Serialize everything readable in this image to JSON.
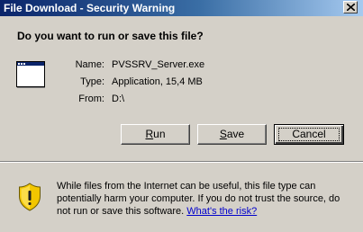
{
  "window": {
    "title": "File Download - Security Warning"
  },
  "dialog": {
    "question": "Do you want to run or save this file?",
    "file": {
      "name_label": "Name:",
      "name_value": "PVSSRV_Server.exe",
      "type_label": "Type:",
      "type_value": "Application, 15,4 MB",
      "from_label": "From:",
      "from_value": "D:\\"
    },
    "buttons": {
      "run": {
        "pre": "",
        "accel": "R",
        "post": "un"
      },
      "save": {
        "pre": "",
        "accel": "S",
        "post": "ave"
      },
      "cancel": "Cancel"
    },
    "warning": {
      "text": "While files from the Internet can be useful, this file type can potentially harm your computer. If you do not trust the source, do not run or save this software. ",
      "link": "What's the risk?"
    }
  },
  "icons": {
    "file": "application-window-icon",
    "shield": "security-shield-warning-icon",
    "close": "close-icon"
  }
}
